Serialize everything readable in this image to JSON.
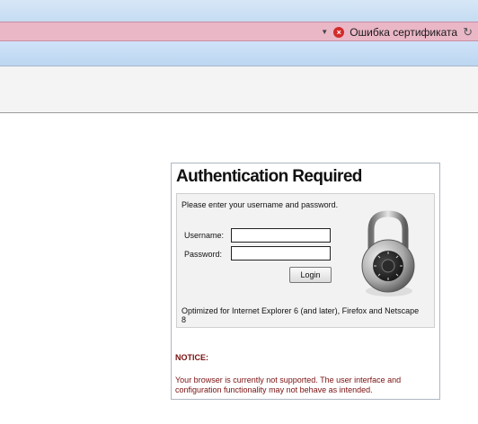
{
  "browser": {
    "certificate_error": "Ошибка сертификата",
    "dropdown_icon": "chevron-down-icon",
    "cert_icon": "error-x-icon",
    "refresh_icon": "refresh-icon",
    "address_bar_color": "#eab7c7"
  },
  "auth": {
    "title": "Authentication Required",
    "prompt": "Please enter your username and password.",
    "username_label": "Username:",
    "username_value": "",
    "password_label": "Password:",
    "password_value": "",
    "login_label": "Login",
    "optimized_text": "Optimized for Internet Explorer 6 (and later), Firefox and Netscape 8",
    "padlock_icon": "padlock-icon"
  },
  "notice": {
    "title": "NOTICE:",
    "text": "Your browser is currently not supported. The user interface and configuration functionality may not behave as intended.",
    "color": "#7a1010"
  }
}
